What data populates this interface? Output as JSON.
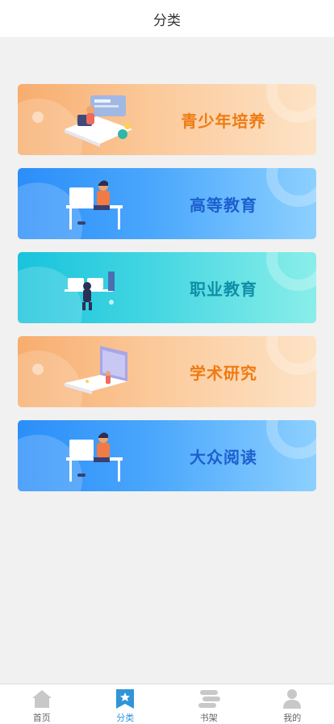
{
  "header": {
    "title": "分类"
  },
  "categories": [
    {
      "label": "青少年培养",
      "theme": "orange"
    },
    {
      "label": "高等教育",
      "theme": "blue"
    },
    {
      "label": "职业教育",
      "theme": "teal"
    },
    {
      "label": "学术研究",
      "theme": "orange"
    },
    {
      "label": "大众阅读",
      "theme": "blue"
    }
  ],
  "tabbar": {
    "items": [
      {
        "label": "首页",
        "icon": "home-icon",
        "active": false
      },
      {
        "label": "分类",
        "icon": "category-bookmark-icon",
        "active": true
      },
      {
        "label": "书架",
        "icon": "bookshelf-icon",
        "active": false
      },
      {
        "label": "我的",
        "icon": "user-icon",
        "active": false
      }
    ]
  },
  "colors": {
    "active_tab": "#2f95d8",
    "orange_text": "#ef7a12",
    "blue_text": "#1d5fcf",
    "teal_text": "#0f8ea6"
  }
}
